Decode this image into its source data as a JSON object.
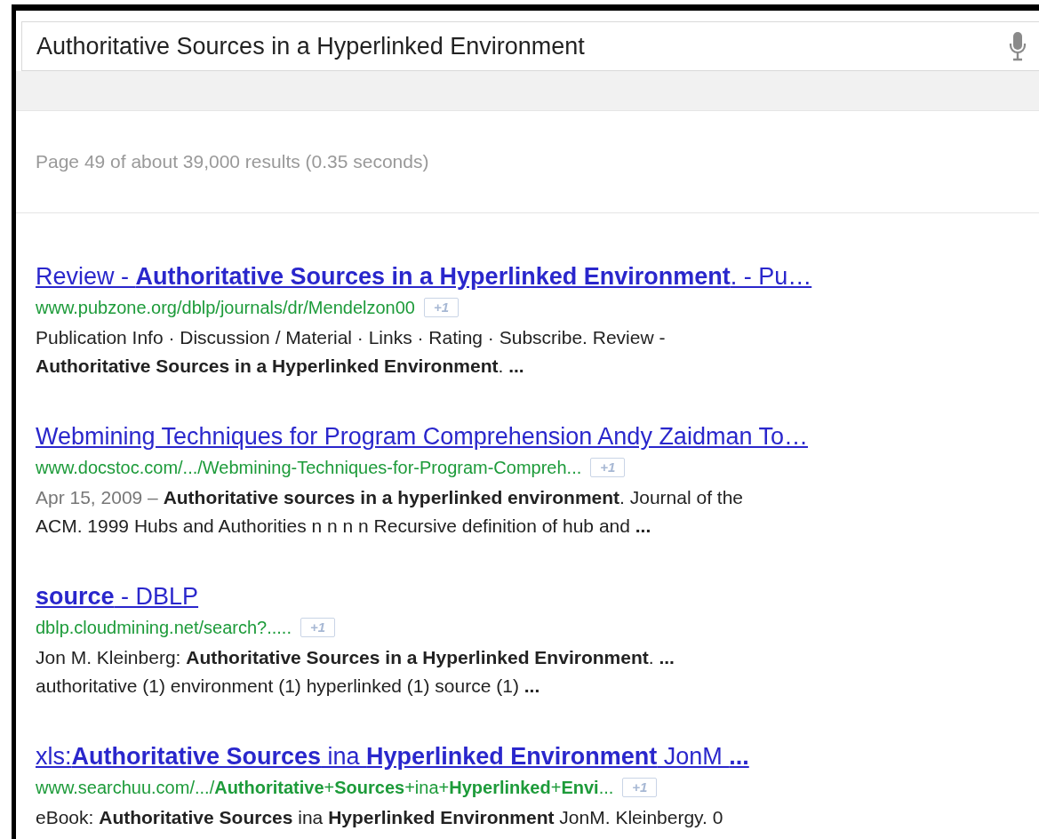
{
  "search": {
    "value": "Authoritative Sources in a Hyperlinked Environment"
  },
  "result_stats": "Page 49 of about 39,000 results (0.35 seconds)",
  "results": [
    {
      "title": "Review - **Authoritative Sources in a Hyperlinked Environment**. - Pu…",
      "url": "www.pubzone.org/dblp/journals/dr/Mendelzon00",
      "plus_one": "+1",
      "snippet": [
        "Publication Info · Discussion / Material · Links · Rating · Subscribe. Review -",
        "**Authoritative Sources in a Hyperlinked Environment**. **...**"
      ]
    },
    {
      "title": "Webmining Techniques for Program Comprehension Andy Zaidman To…",
      "url": "www.docstoc.com/.../Webmining-Techniques-for-Program-Compreh...",
      "plus_one": "+1",
      "date": "Apr 15, 2009 –",
      "snippet": [
        "**Authoritative sources in a hyperlinked environment**. Journal of the",
        "ACM. 1999 Hubs and Authorities n n n n Recursive definition of hub and **...**"
      ]
    },
    {
      "title": "**source** - DBLP",
      "url": "dblp.cloudmining.net/search?.....",
      "plus_one": "+1",
      "snippet": [
        "Jon M. Kleinberg: **Authoritative Sources in a Hyperlinked Environment**. **...**",
        "authoritative (1) environment (1) hyperlinked (1) source (1) **...**"
      ]
    },
    {
      "title": "xls:**Authoritative Sources** ina **Hyperlinked Environment** JonM **...**",
      "url": "www.searchuu.com/.../**Authoritative**+**Sources**+ina+**Hyperlinked**+**Envi**...",
      "plus_one": "+1",
      "snippet": [
        "eBook: **Authoritative Sources** ina **Hyperlinked Environment** JonM. Kleinbergy. 0"
      ]
    }
  ]
}
